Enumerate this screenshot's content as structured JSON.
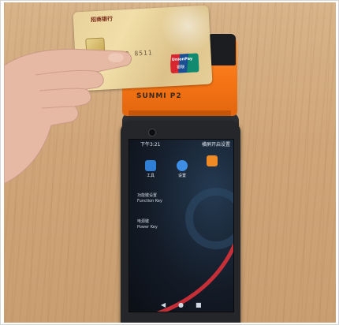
{
  "card": {
    "bank_name": "招商银行",
    "number_fragment": "2333 8511",
    "network_name": "UnionPay",
    "network_cn": "银联"
  },
  "printer": {
    "brand": "SUNMI P2"
  },
  "screen": {
    "status_time": "下午3:21",
    "status_right": "横屏开启设置",
    "apps": [
      {
        "label": "工具",
        "icon": "tools-icon",
        "color": "#2f7fd6"
      },
      {
        "label": "设置",
        "icon": "settings-icon",
        "color": "#3e8ee6"
      },
      {
        "label": "",
        "icon": "gift-icon",
        "color": "#f08a24"
      }
    ],
    "labels": [
      "功能键设置",
      "Function Key",
      "电源键",
      "Power Key"
    ]
  },
  "colors": {
    "printer_orange": "#f47314",
    "device_body": "#24262a",
    "card_gold": "#e9d29c",
    "wood": "#cfa679"
  }
}
